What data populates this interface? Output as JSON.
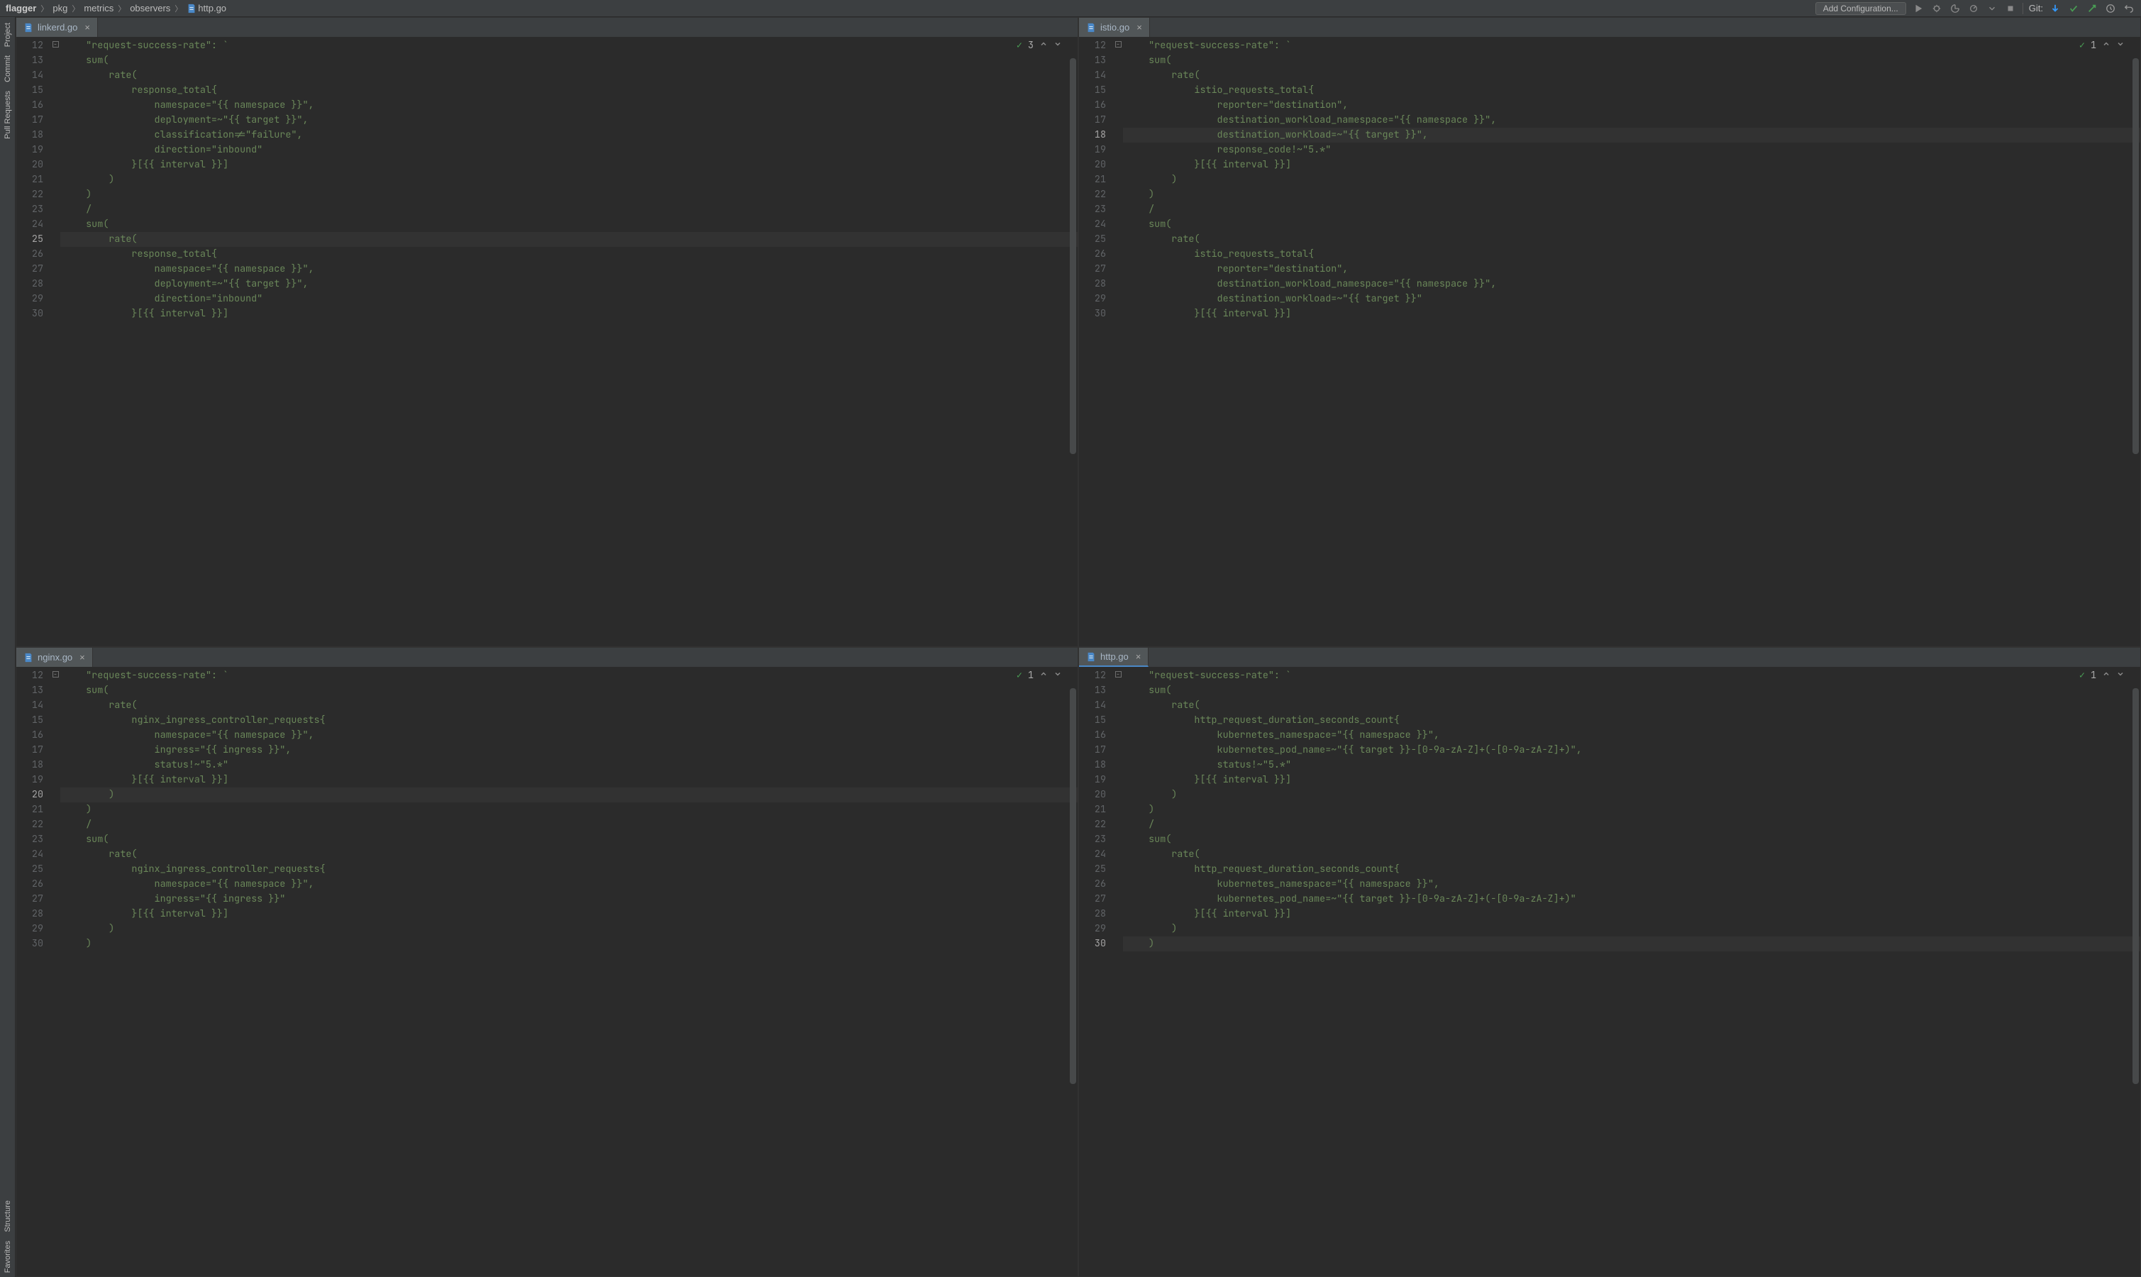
{
  "breadcrumbs": {
    "root": "flagger",
    "parts": [
      "pkg",
      "metrics",
      "observers"
    ],
    "file": "http.go"
  },
  "runConfig": {
    "label": "Add Configuration..."
  },
  "git": {
    "label": "Git:"
  },
  "tools": {
    "project": "Project",
    "commit": "Commit",
    "pullRequests": "Pull Requests",
    "structure": "Structure",
    "favorites": "Favorites"
  },
  "panes": [
    {
      "tab": "linkerd.go",
      "problems": "3",
      "activeBottom": false,
      "highlightLine": 25,
      "startLine": 12,
      "code": [
        "\"request-success-rate\": `",
        "sum(",
        "    rate(",
        "        response_total{",
        "            namespace=\"{{ namespace }}\",",
        "            deployment=~\"{{ target }}\",",
        "            classification!=\"failure\",",
        "            direction=\"inbound\"",
        "        }[{{ interval }}]",
        "    )",
        ")",
        "/",
        "sum(",
        "    rate(",
        "        response_total{",
        "            namespace=\"{{ namespace }}\",",
        "            deployment=~\"{{ target }}\",",
        "            direction=\"inbound\"",
        "        }[{{ interval }}]"
      ]
    },
    {
      "tab": "istio.go",
      "problems": "1",
      "activeBottom": false,
      "highlightLine": 18,
      "startLine": 12,
      "code": [
        "\"request-success-rate\": `",
        "sum(",
        "    rate(",
        "        istio_requests_total{",
        "            reporter=\"destination\",",
        "            destination_workload_namespace=\"{{ namespace }}\",",
        "            destination_workload=~\"{{ target }}\",",
        "            response_code!~\"5.*\"",
        "        }[{{ interval }}]",
        "    )",
        ")",
        "/",
        "sum(",
        "    rate(",
        "        istio_requests_total{",
        "            reporter=\"destination\",",
        "            destination_workload_namespace=\"{{ namespace }}\",",
        "            destination_workload=~\"{{ target }}\"",
        "        }[{{ interval }}]"
      ]
    },
    {
      "tab": "nginx.go",
      "problems": "1",
      "activeBottom": false,
      "highlightLine": 20,
      "startLine": 12,
      "code": [
        "\"request-success-rate\": `",
        "sum(",
        "    rate(",
        "        nginx_ingress_controller_requests{",
        "            namespace=\"{{ namespace }}\",",
        "            ingress=\"{{ ingress }}\",",
        "            status!~\"5.*\"",
        "        }[{{ interval }}]",
        "    )",
        ")",
        "/",
        "sum(",
        "    rate(",
        "        nginx_ingress_controller_requests{",
        "            namespace=\"{{ namespace }}\",",
        "            ingress=\"{{ ingress }}\"",
        "        }[{{ interval }}]",
        "    )",
        ")"
      ]
    },
    {
      "tab": "http.go",
      "problems": "1",
      "activeBottom": true,
      "highlightLine": 30,
      "startLine": 12,
      "code": [
        "\"request-success-rate\": `",
        "sum(",
        "    rate(",
        "        http_request_duration_seconds_count{",
        "            kubernetes_namespace=\"{{ namespace }}\",",
        "            kubernetes_pod_name=~\"{{ target }}-[0-9a-zA-Z]+(-[0-9a-zA-Z]+)\",",
        "            status!~\"5.*\"",
        "        }[{{ interval }}]",
        "    )",
        ")",
        "/",
        "sum(",
        "    rate(",
        "        http_request_duration_seconds_count{",
        "            kubernetes_namespace=\"{{ namespace }}\",",
        "            kubernetes_pod_name=~\"{{ target }}-[0-9a-zA-Z]+(-[0-9a-zA-Z]+)\"",
        "        }[{{ interval }}]",
        "    )",
        ")"
      ]
    }
  ]
}
